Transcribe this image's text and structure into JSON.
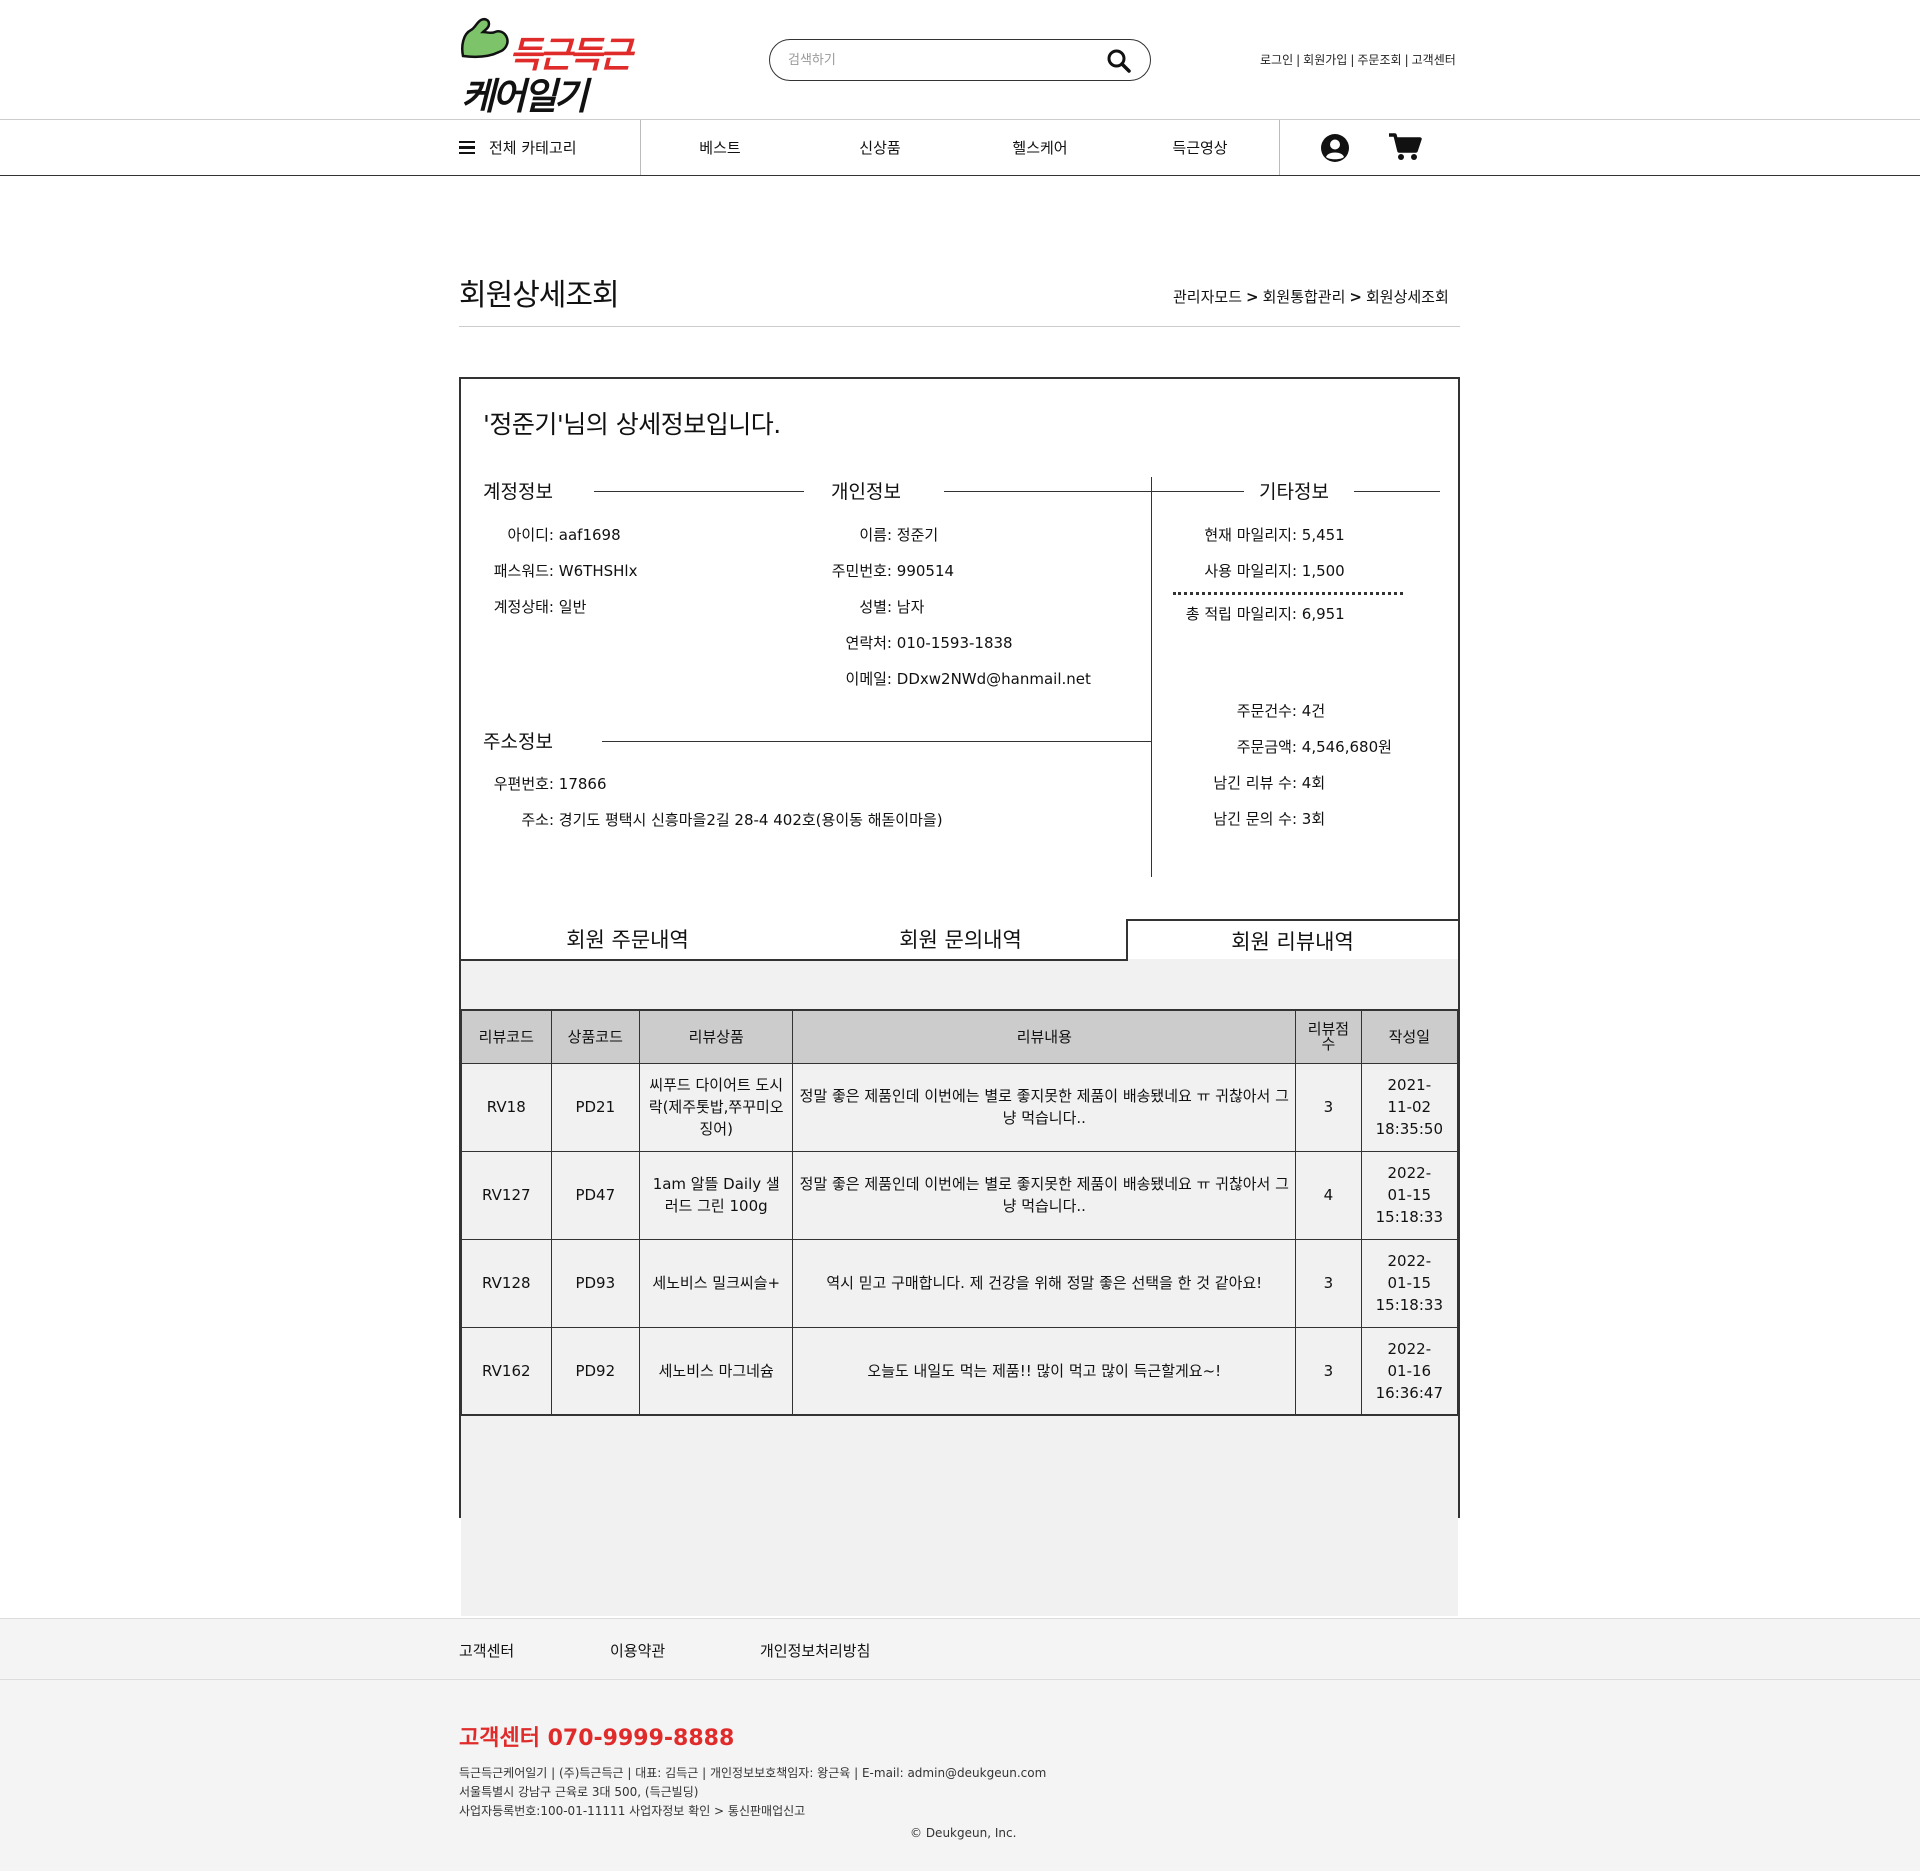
{
  "brand": {
    "line1": "득근득근",
    "line2": "케어일기"
  },
  "search": {
    "placeholder": "검색하기"
  },
  "top_links": [
    "로그인",
    "회원가입",
    "주문조회",
    "고객센터"
  ],
  "nav": {
    "all_category": "전체 카테고리",
    "menus": [
      "베스트",
      "신상품",
      "헬스케어",
      "득근영상"
    ]
  },
  "page": {
    "title": "회원상세조회",
    "breadcrumb": [
      "관리자모드",
      "회원통합관리",
      "회원상세조회"
    ]
  },
  "detail": {
    "headline": "'정준기'님의 상세정보입니다.",
    "account": {
      "title": "계정정보",
      "id_label": "아이디:",
      "id": "aaf1698",
      "pw_label": "패스워드:",
      "pw": "W6THSHlx",
      "status_label": "계정상태:",
      "status": "일반"
    },
    "personal": {
      "title": "개인정보",
      "name_label": "이름:",
      "name": "정준기",
      "rrn_label": "주민번호:",
      "rrn": "990514",
      "gender_label": "성별:",
      "gender": "남자",
      "phone_label": "연락처:",
      "phone": "010-1593-1838",
      "email_label": "이메일:",
      "email": "DDxw2NWd@hanmail.net"
    },
    "address": {
      "title": "주소정보",
      "zip_label": "우편번호:",
      "zip": "17866",
      "addr_label": "주소:",
      "addr": "경기도 평택시 신흥마을2길 28-4 402호(용이동 해돋이마을)"
    },
    "etc": {
      "title": "기타정보",
      "cur_mileage_label": "현재 마일리지:",
      "cur_mileage": "5,451",
      "used_mileage_label": "사용 마일리지:",
      "used_mileage": "1,500",
      "total_mileage_label": "총 적립 마일리지:",
      "total_mileage": "6,951",
      "order_count_label": "주문건수:",
      "order_count": "4건",
      "order_amount_label": "주문금액:",
      "order_amount": "4,546,680원",
      "review_count_label": "남긴 리뷰 수:",
      "review_count": "4회",
      "inquiry_count_label": "남긴 문의 수:",
      "inquiry_count": "3회"
    },
    "tabs": [
      "회원 주문내역",
      "회원 문의내역",
      "회원 리뷰내역"
    ],
    "active_tab": "회원 리뷰내역"
  },
  "reviews": {
    "headers": [
      "리뷰코드",
      "상품코드",
      "리뷰상품",
      "리뷰내용",
      "리뷰점수",
      "작성일"
    ],
    "rows": [
      {
        "code": "RV18",
        "product_code": "PD21",
        "product": "씨푸드 다이어트 도시락(제주톳밥,쭈꾸미오징어)",
        "content": "정말 좋은 제품인데 이번에는 별로 좋지못한 제품이 배송됐네요 ㅠ 귀찮아서 그냥 먹습니다..",
        "score": "3",
        "date": "2021-11-02 18:35:50"
      },
      {
        "code": "RV127",
        "product_code": "PD47",
        "product": "1am 알뜰 Daily 샐러드 그린 100g",
        "content": "정말 좋은 제품인데 이번에는 별로 좋지못한 제품이 배송됐네요 ㅠ 귀찮아서 그냥 먹습니다..",
        "score": "4",
        "date": "2022-01-15 15:18:33"
      },
      {
        "code": "RV128",
        "product_code": "PD93",
        "product": "세노비스 밀크씨슬+",
        "content": "역시 믿고 구매합니다. 제 건강을 위해 정말 좋은 선택을 한 것 같아요!",
        "score": "3",
        "date": "2022-01-15 15:18:33"
      },
      {
        "code": "RV162",
        "product_code": "PD92",
        "product": "세노비스 마그네슘",
        "content": "오늘도 내일도 먹는 제품!! 많이 먹고 많이 득근할게요~!",
        "score": "3",
        "date": "2022-01-16 16:36:47"
      }
    ]
  },
  "footer": {
    "links": [
      "고객센터",
      "이용약관",
      "개인정보처리방침"
    ],
    "cs": "고객센터 070-9999-8888",
    "line1": "득근득근케어일기 | (주)득근득근 | 대표: 김득근 | 개인정보보호책임자: 왕근육 | E-mail: admin@deukgeun.com",
    "line2": "서울특별시 강남구 근육로 3대 500, (득근빌딩)",
    "line3": "사업자등록번호:100-01-11111 사업자정보 확인 > 통신판매업신고",
    "copyright": "© Deukgeun, Inc."
  },
  "colors": {
    "brand_red": "#e02b2b",
    "logo_green": "#7cc36a",
    "table_header": "#cccccc",
    "panel_grey": "#f1f1f1"
  }
}
